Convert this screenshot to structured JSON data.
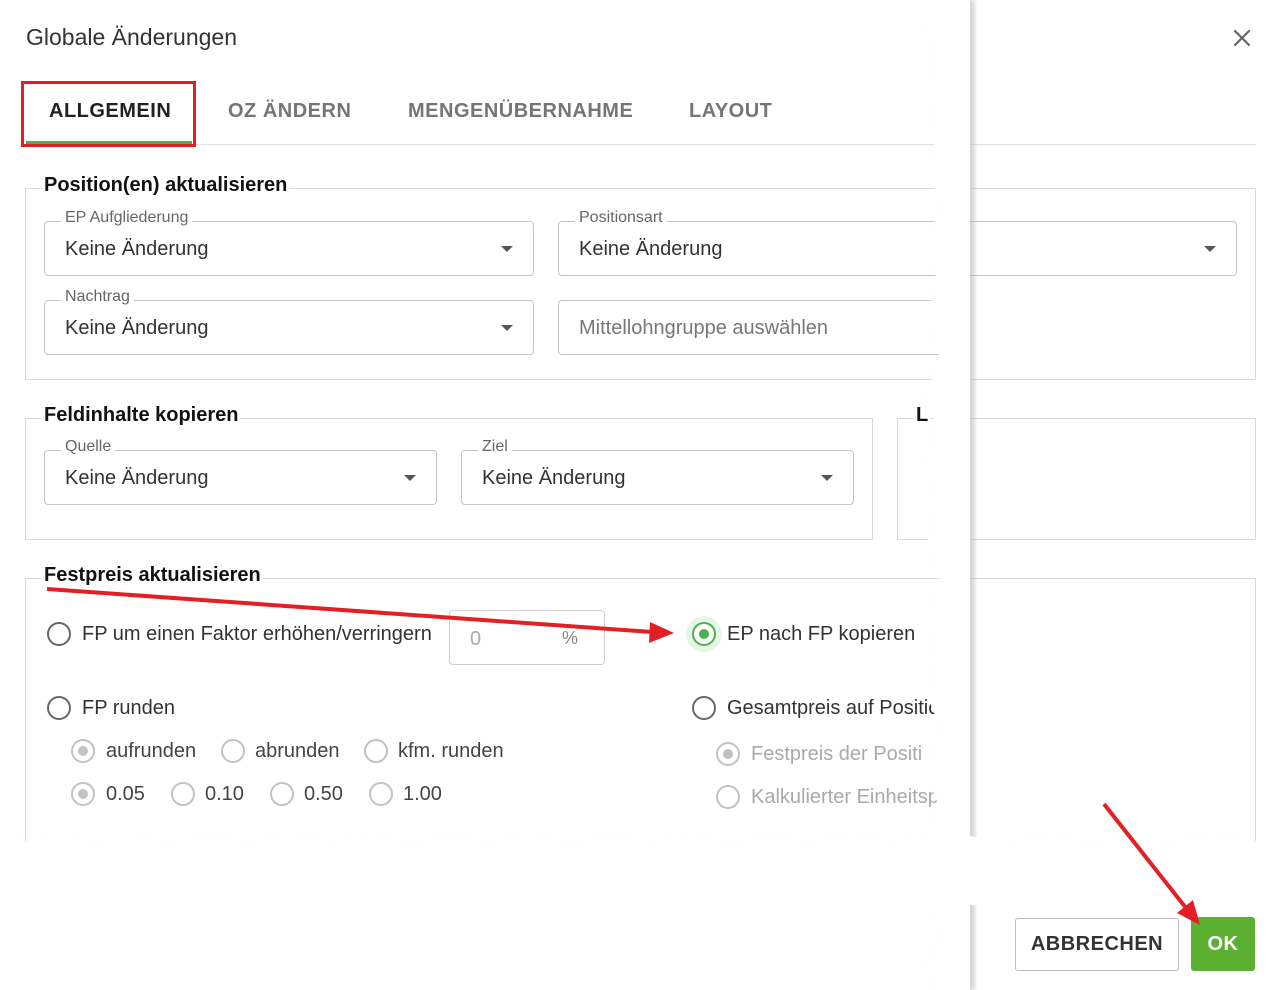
{
  "dialog": {
    "title": "Globale Änderungen"
  },
  "tabs": [
    {
      "label": "ALLGEMEIN",
      "active": true
    },
    {
      "label": "OZ ÄNDERN",
      "active": false
    },
    {
      "label": "MENGENÜBERNAHME",
      "active": false
    },
    {
      "label": "LAYOUT",
      "active": false
    }
  ],
  "section_positions": {
    "legend": "Position(en) aktualisieren",
    "ep_aufgliederung": {
      "label": "EP Aufgliederung",
      "value": "Keine Änderung"
    },
    "positionsart": {
      "label": "Positionsart",
      "value": "Keine Änderung"
    },
    "nachtrag": {
      "label": "Nachtrag",
      "value": "Keine Änderung"
    },
    "mittellohn": {
      "placeholder": "Mittellohngruppe auswählen"
    }
  },
  "section_copy": {
    "legend": "Feldinhalte kopieren",
    "quelle": {
      "label": "Quelle",
      "value": "Keine Änderung"
    },
    "ziel": {
      "label": "Ziel",
      "value": "Keine Änderung"
    },
    "right_legend_fragment": "L"
  },
  "section_festpreis": {
    "legend": "Festpreis aktualisieren",
    "factor_option": "FP um einen Faktor erhöhen/verringern",
    "factor_value": "0",
    "factor_unit": "%",
    "ep_copy_option": "EP nach FP kopieren",
    "round_option": "FP runden",
    "gesamt_option": "Gesamtpreis auf Positio",
    "round_modes": [
      "aufrunden",
      "abrunden",
      "kfm. runden"
    ],
    "round_steps": [
      "0.05",
      "0.10",
      "0.50",
      "1.00"
    ],
    "gesamt_sub": [
      "Festpreis der Positi",
      "Kalkulierter Einheitsp"
    ]
  },
  "actions": {
    "cancel": "ABBRECHEN",
    "ok": "OK"
  },
  "colors": {
    "accent": "#4caf50",
    "ok_button": "#5cb031",
    "annotation": "#e31e24"
  }
}
